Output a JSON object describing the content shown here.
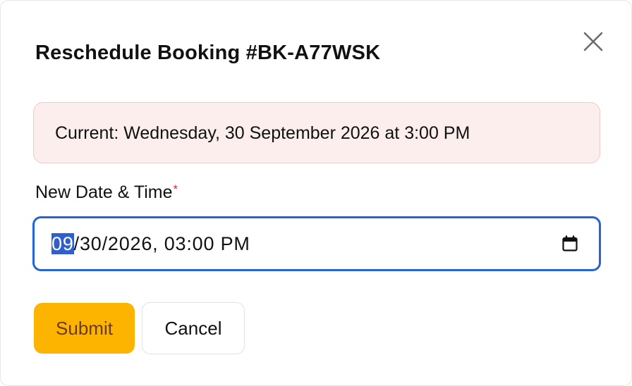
{
  "dialog": {
    "title": "Reschedule Booking #BK-A77WSK",
    "close_icon": "close-icon"
  },
  "current_booking": {
    "text": "Current: Wednesday, 30 September 2026 at 3:00 PM",
    "colors": {
      "background": "#fdeeee",
      "border": "#f3c8c8"
    }
  },
  "new_datetime": {
    "label": "New Date & Time",
    "required_mark": "*",
    "value": {
      "month": "09",
      "rest": "/30/2026, 03:00 PM"
    },
    "selected_segment": "month",
    "icon": "calendar-icon",
    "focus_color": "#2563d9"
  },
  "actions": {
    "submit_label": "Submit",
    "cancel_label": "Cancel",
    "submit_color": "#fdb400"
  }
}
